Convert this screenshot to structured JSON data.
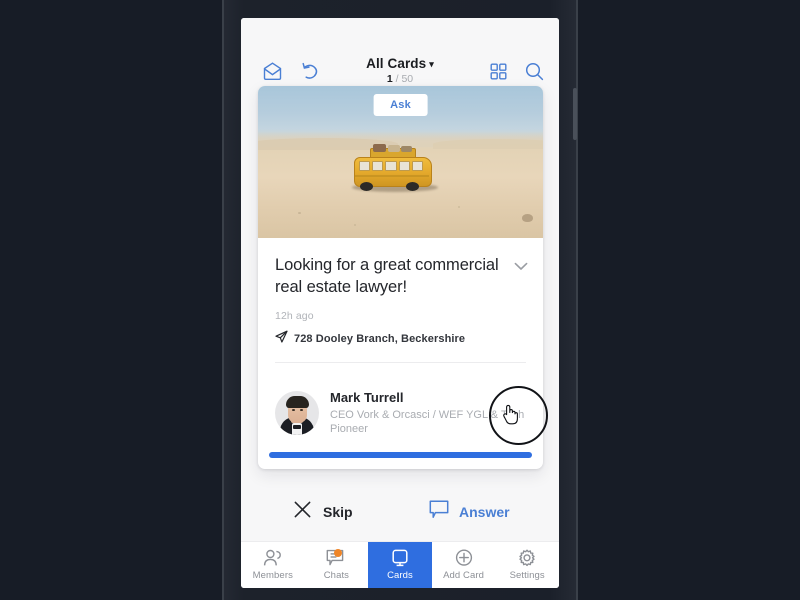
{
  "device": {
    "frame_color": "#20252f",
    "screen_bg": "#f7f7f8"
  },
  "topbar": {
    "inbox_icon": "inbox-icon",
    "undo_icon": "undo-icon",
    "grid_icon": "grid-view-icon",
    "search_icon": "search-icon",
    "title": "All Cards",
    "caret": "▾",
    "counter_current": "1",
    "counter_separator": "/",
    "counter_total": "50"
  },
  "card": {
    "badge_label": "Ask",
    "badge_text_color": "#4a7fd4",
    "title": "Looking for a great commercial real estate lawyer!",
    "expand_icon": "chevron-down-icon",
    "time_ago": "12h ago",
    "location_icon": "send-location-icon",
    "location": "728 Dooley Branch, Beckershire",
    "profile": {
      "avatar_icon": "avatar",
      "name": "Mark Turrell",
      "role": "CEO Vork & Orcasci / WEF YGL & Tech Pioneer"
    },
    "progress_color": "#2f6ee0",
    "progress_percent": 100
  },
  "actions": {
    "skip_icon": "close-x-icon",
    "skip_label": "Skip",
    "answer_icon": "speech-bubble-icon",
    "answer_label": "Answer",
    "answer_color": "#4a7fd4"
  },
  "bottom_nav": {
    "active_color": "#2f6ee0",
    "badge_color": "#ef8527",
    "items": [
      {
        "icon": "members-icon",
        "label": "Members",
        "active": false,
        "badge": false
      },
      {
        "icon": "chats-icon",
        "label": "Chats",
        "active": false,
        "badge": true
      },
      {
        "icon": "cards-icon",
        "label": "Cards",
        "active": true,
        "badge": false
      },
      {
        "icon": "add-card-icon",
        "label": "Add Card",
        "active": false,
        "badge": false
      },
      {
        "icon": "settings-icon",
        "label": "Settings",
        "active": false,
        "badge": false
      }
    ]
  },
  "overlay": {
    "click_indicator_icon": "click-ring-indicator",
    "cursor_icon": "pointing-hand-cursor"
  }
}
